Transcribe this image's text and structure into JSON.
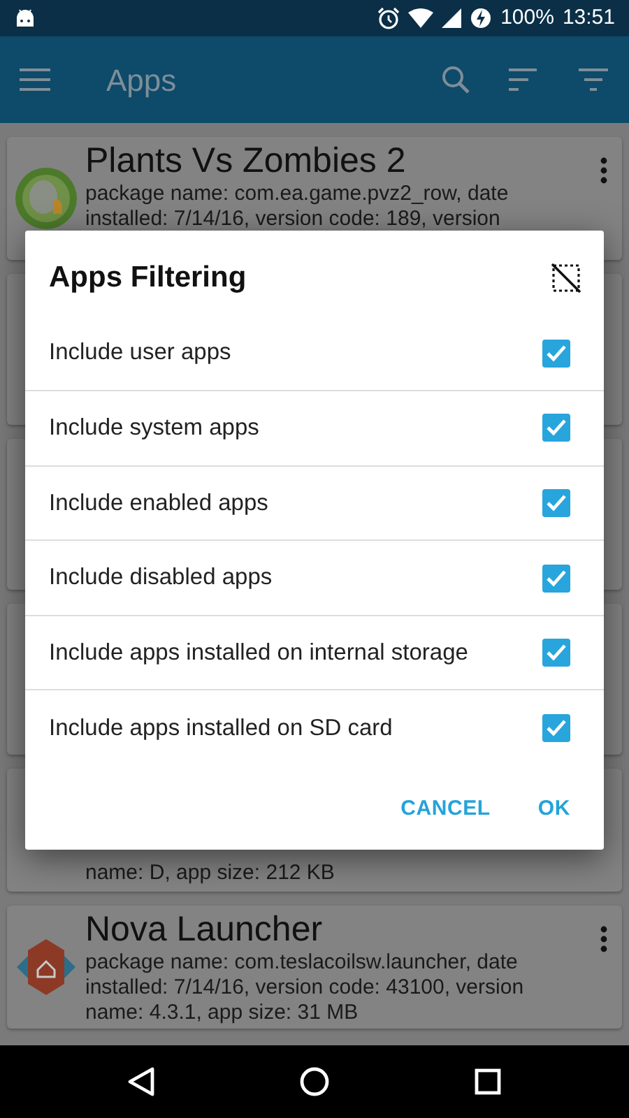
{
  "status_bar": {
    "battery": "100%",
    "time": "13:51"
  },
  "app_bar": {
    "title": "Apps"
  },
  "apps": [
    {
      "kind": "pvz",
      "name": "Plants Vs Zombies 2",
      "description_lines": [
        "package name: com.ea.game.pvz2_row, date",
        "installed: 7/14/16, version code: 189, version"
      ]
    },
    {
      "kind": "partial",
      "description_lines": [
        "name: D, app size: 212 KB"
      ]
    },
    {
      "kind": "nova",
      "name": "Nova Launcher",
      "description_lines": [
        "package name: com.teslacoilsw.launcher, date",
        "installed: 7/14/16, version code: 43100, version",
        "name: 4.3.1, app size: 31 MB"
      ]
    }
  ],
  "dialog": {
    "title": "Apps Filtering",
    "options": [
      {
        "label": "Include user apps",
        "checked": true
      },
      {
        "label": "Include system apps",
        "checked": true
      },
      {
        "label": "Include enabled apps",
        "checked": true
      },
      {
        "label": "Include disabled apps",
        "checked": true
      },
      {
        "label": "Include apps installed on internal storage",
        "checked": true
      },
      {
        "label": "Include apps installed on SD card",
        "checked": true
      }
    ],
    "buttons": [
      "CANCEL",
      "OK"
    ]
  }
}
